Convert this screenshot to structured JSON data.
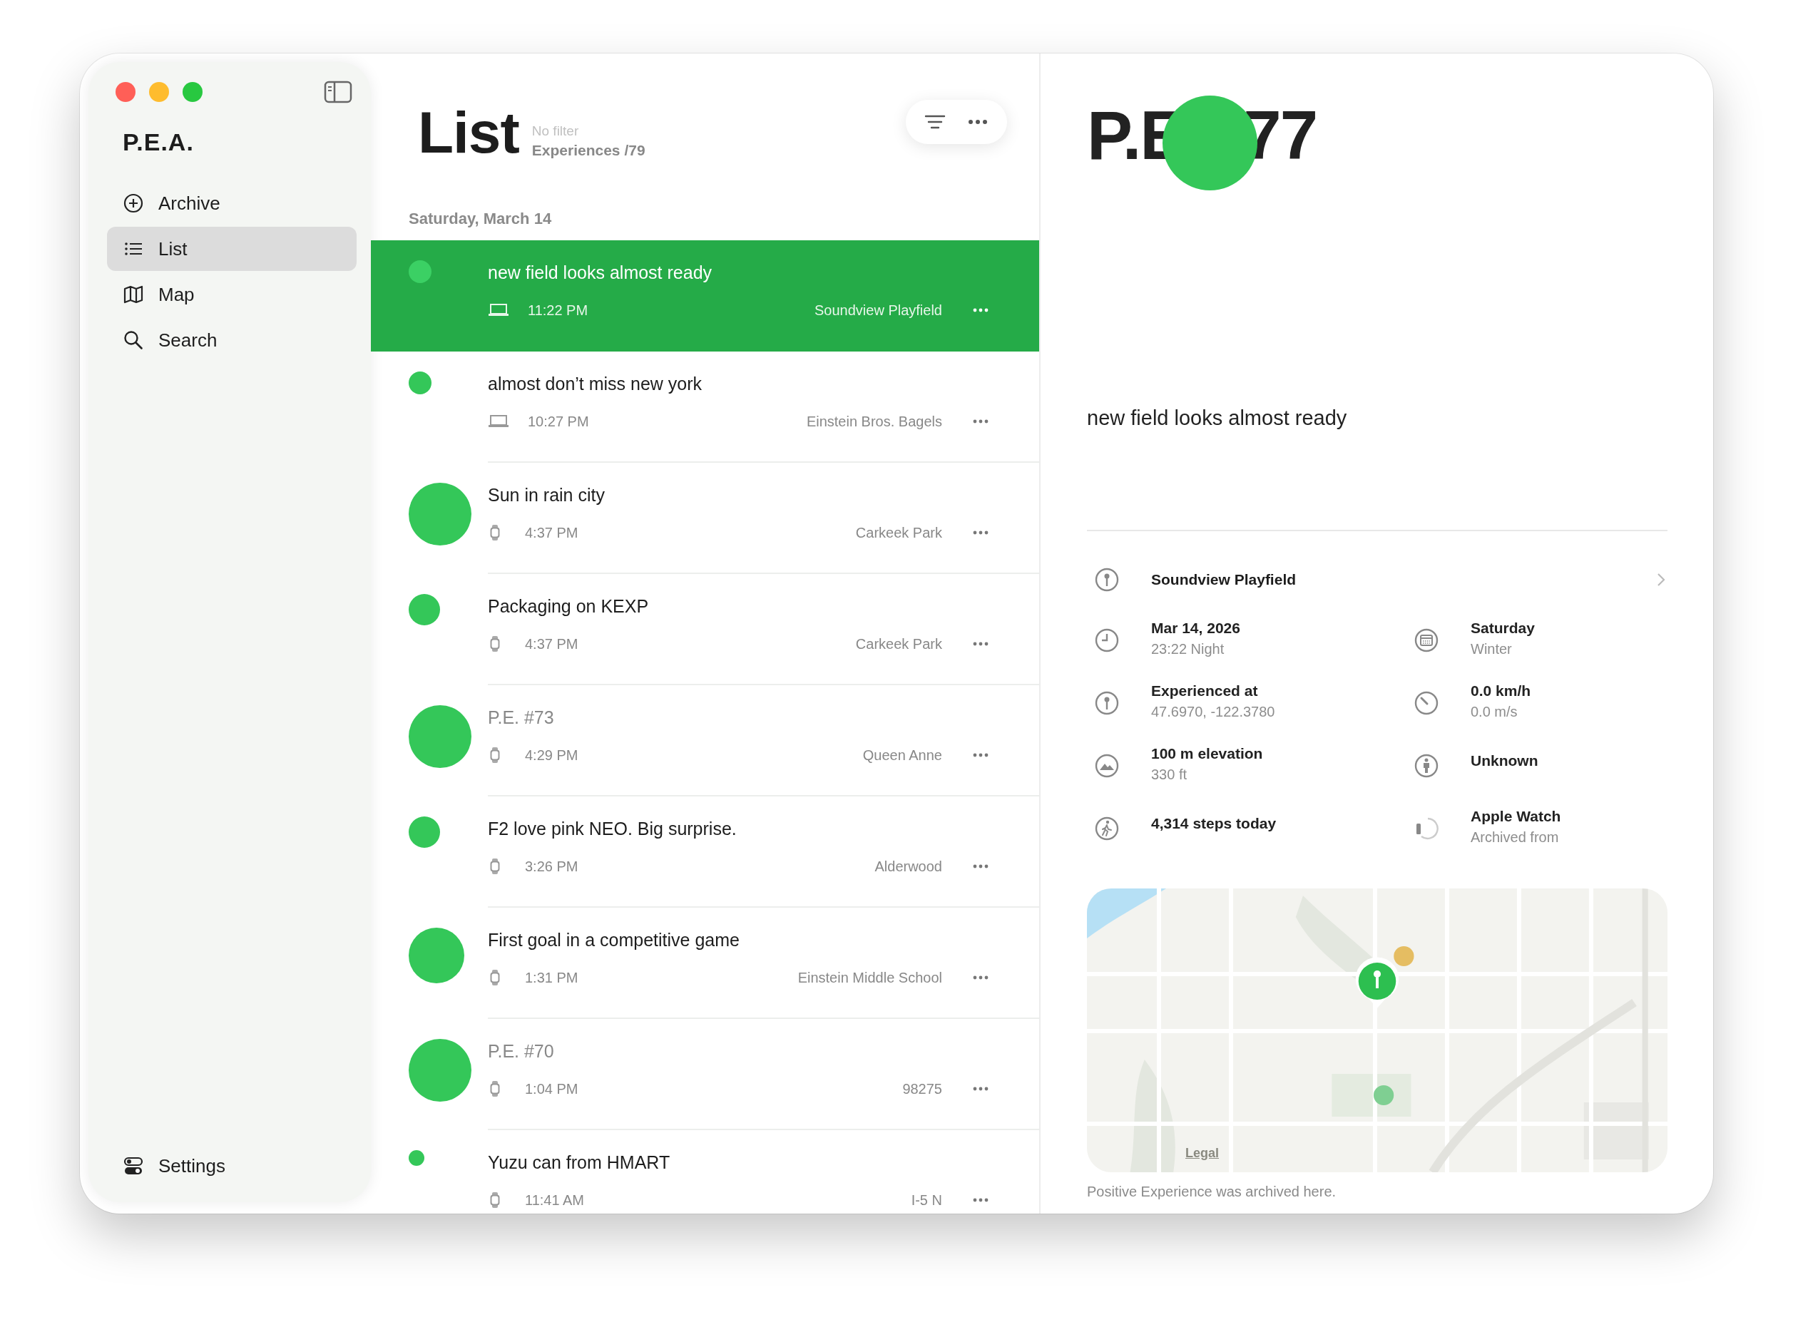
{
  "sidebar": {
    "app_title": "P.E.A.",
    "items": [
      {
        "kind": "archive",
        "label": "Archive",
        "selected": false
      },
      {
        "kind": "list",
        "label": "List",
        "selected": true
      },
      {
        "kind": "map",
        "label": "Map",
        "selected": false
      },
      {
        "kind": "search",
        "label": "Search",
        "selected": false
      }
    ],
    "footer": {
      "label": "Settings"
    }
  },
  "list": {
    "title": "List",
    "filter": "No filter",
    "count": "Experiences /79",
    "section": "Saturday, March 14",
    "rows": [
      {
        "title": "new field looks almost ready",
        "untitled": false,
        "kind": "laptop",
        "time": "11:22 PM",
        "place": "Soundview Playfield",
        "selected": true
      },
      {
        "title": "almost don’t miss new york",
        "untitled": false,
        "kind": "laptop",
        "time": "10:27 PM",
        "place": "Einstein Bros. Bagels",
        "selected": false
      },
      {
        "title": "Sun in rain city",
        "untitled": false,
        "kind": "watch",
        "time": "4:37 PM",
        "place": "Carkeek Park",
        "selected": false
      },
      {
        "title": "Packaging on KEXP",
        "untitled": false,
        "kind": "watch",
        "time": "4:37 PM",
        "place": "Carkeek Park",
        "selected": false
      },
      {
        "title": "P.E. #73",
        "untitled": true,
        "kind": "watch",
        "time": "4:29 PM",
        "place": "Queen Anne",
        "selected": false
      },
      {
        "title": "F2 love pink NEO. Big surprise.",
        "untitled": false,
        "kind": "watch",
        "time": "3:26 PM",
        "place": "Alderwood",
        "selected": false
      },
      {
        "title": "First goal in a competitive game",
        "untitled": false,
        "kind": "watch",
        "time": "1:31 PM",
        "place": "Einstein Middle School",
        "selected": false
      },
      {
        "title": "P.E. #70",
        "untitled": true,
        "kind": "watch",
        "time": "1:04 PM",
        "place": "98275",
        "selected": false
      },
      {
        "title": "Yuzu can from HMART",
        "untitled": false,
        "kind": "watch",
        "time": "11:41 AM",
        "place": "I-5 N",
        "selected": false
      }
    ]
  },
  "detail": {
    "title_parts": [
      "P.E",
      "77"
    ],
    "note": "new field looks almost ready",
    "place": "Soundview Playfield",
    "facts": [
      {
        "kind": "clock",
        "primary": "Mar 14, 2026",
        "secondary": "23:22  Night"
      },
      {
        "kind": "calendar",
        "primary": "Saturday",
        "secondary": "Winter"
      },
      {
        "kind": "pin",
        "primary": "Experienced at",
        "secondary": "47.6970, -122.3780"
      },
      {
        "kind": "speed",
        "primary": "0.0 km/h",
        "secondary": "0.0 m/s"
      },
      {
        "kind": "elevation",
        "primary": "100 m elevation",
        "secondary": "330 ft"
      },
      {
        "kind": "person",
        "primary": "Unknown"
      },
      {
        "kind": "steps",
        "primary": "4,314 steps today"
      },
      {
        "kind": "watch",
        "primary": "Apple Watch",
        "secondary": "Archived from"
      }
    ],
    "map": {
      "kind": "picture",
      "legal": "Legal"
    },
    "caption": "Positive Experience was archived here."
  }
}
